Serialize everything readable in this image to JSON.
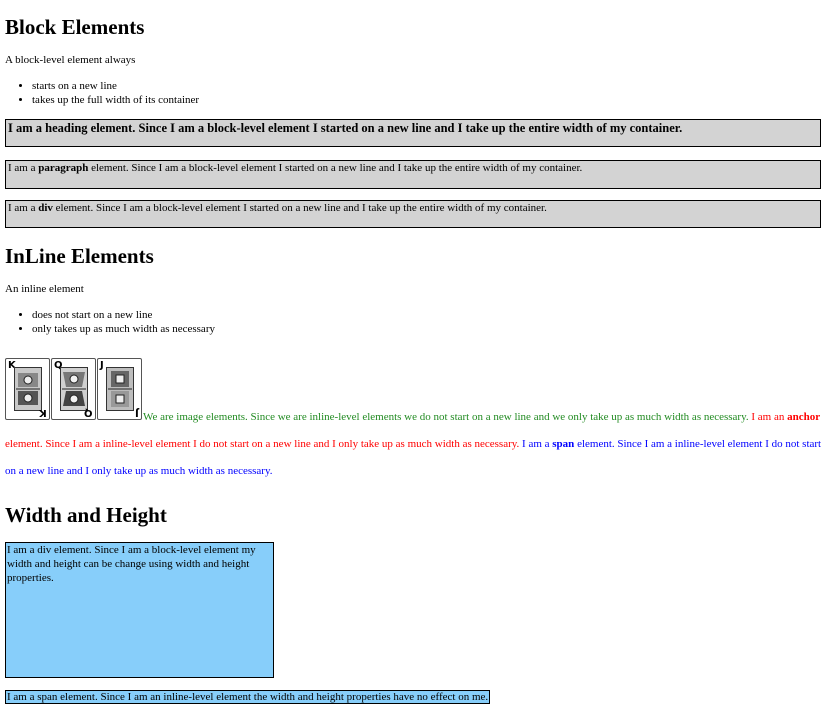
{
  "block": {
    "heading": "Block Elements",
    "intro": "A block-level element always",
    "bullets": [
      "starts on a new line",
      "takes up the full width of its container"
    ],
    "heading_box": "I am a heading element. Since I am a block-level element I started on a new line and I take up the entire width of my container.",
    "para_pre": "I am a ",
    "para_bold": "paragraph",
    "para_post": " element. Since I am a block-level element I started on a new line and I take up the entire width of my container.",
    "div_pre": "I am a ",
    "div_bold": "div",
    "div_post": " element. Since I am a block-level element I started on a new line and I take up the entire width of my container."
  },
  "inline": {
    "heading": "InLine Elements",
    "intro": "An inline element",
    "bullets": [
      "does not start on a new line",
      "only takes up as much width as necessary"
    ],
    "cards": [
      {
        "rank": "K",
        "suit": "♣",
        "name": "king-of-clubs"
      },
      {
        "rank": "Q",
        "suit": "♣",
        "name": "queen-of-clubs"
      },
      {
        "rank": "J",
        "suit": "♣",
        "name": "jack-of-clubs"
      }
    ],
    "image_text": "We are image elements. Since we are inline-level elements we do not start on a new line and we only take up as much width as necessary.",
    "anchor_pre": " I am an ",
    "anchor_bold": "anchor",
    "anchor_post": " element. Since I am a inline-level element I do not start on a new line and I only take up as much width as necessary.",
    "span_pre": " I am a ",
    "span_bold": "span",
    "span_post": " element. Since I am a inline-level element I do not start on a new line and I only take up as much width as necessary."
  },
  "wh": {
    "heading": "Width and Height",
    "div_text": "I am a div element. Since I am a block-level element my width and height can be change using width and height properties.",
    "span_text": "I am a span element. Since I am an inline-level element the width and height properties have no effect on me."
  },
  "colors": {
    "gray": "#d3d3d3",
    "green": "#228b22",
    "red": "#ff0000",
    "blue": "#0000ff",
    "lightblue": "#87cefa"
  }
}
